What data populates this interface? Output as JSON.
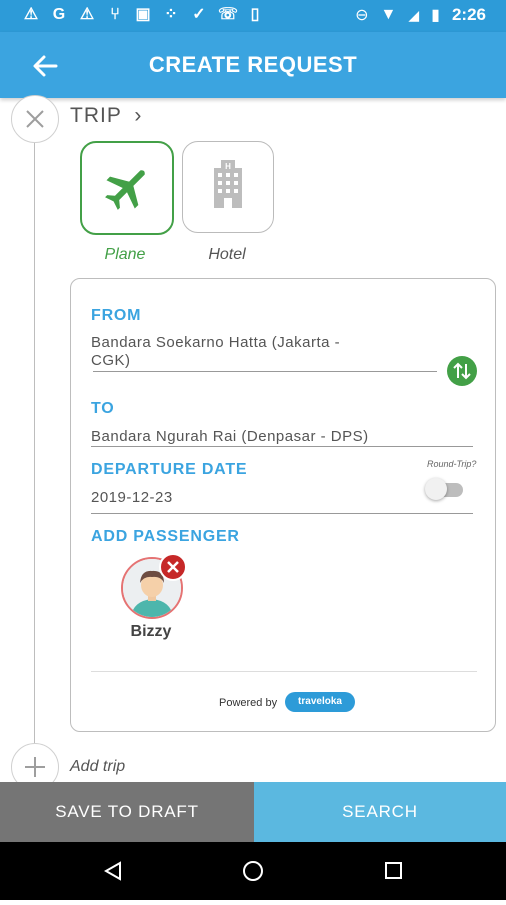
{
  "status_bar": {
    "time": "2:26",
    "left_icons": [
      "alert-icon",
      "g-icon",
      "alert-icon",
      "usb-icon",
      "image-icon",
      "dots-icon",
      "check-icon",
      "whatsapp-icon",
      "phone-icon"
    ],
    "right_icons": [
      "dnd-icon",
      "wifi-icon",
      "signal-icon",
      "battery-icon"
    ]
  },
  "app_bar": {
    "title": "CREATE REQUEST"
  },
  "trip": {
    "label": "TRIP",
    "options": [
      {
        "label": "Plane",
        "selected": true
      },
      {
        "label": "Hotel",
        "selected": false
      }
    ]
  },
  "form": {
    "from_label": "FROM",
    "from_value_line1": "Bandara Soekarno Hatta (Jakarta -",
    "from_value_line2": "CGK)",
    "to_label": "TO",
    "to_value": "Bandara Ngurah Rai (Denpasar - DPS)",
    "departure_label": "DEPARTURE DATE",
    "departure_value": "2019-12-23",
    "round_trip_label": "Round-Trip?",
    "round_trip_on": false,
    "add_passenger_label": "ADD PASSENGER",
    "passengers": [
      {
        "name": "Bizzy"
      }
    ],
    "powered_by": "Powered by",
    "brand": "traveloka"
  },
  "add_trip": "Add trip",
  "actions": {
    "save_draft": "SAVE TO DRAFT",
    "search": "SEARCH"
  },
  "colors": {
    "primary": "#3ba4e0",
    "green": "#43a047",
    "draft_bg": "#757575",
    "search_bg": "#5bb8e0"
  }
}
